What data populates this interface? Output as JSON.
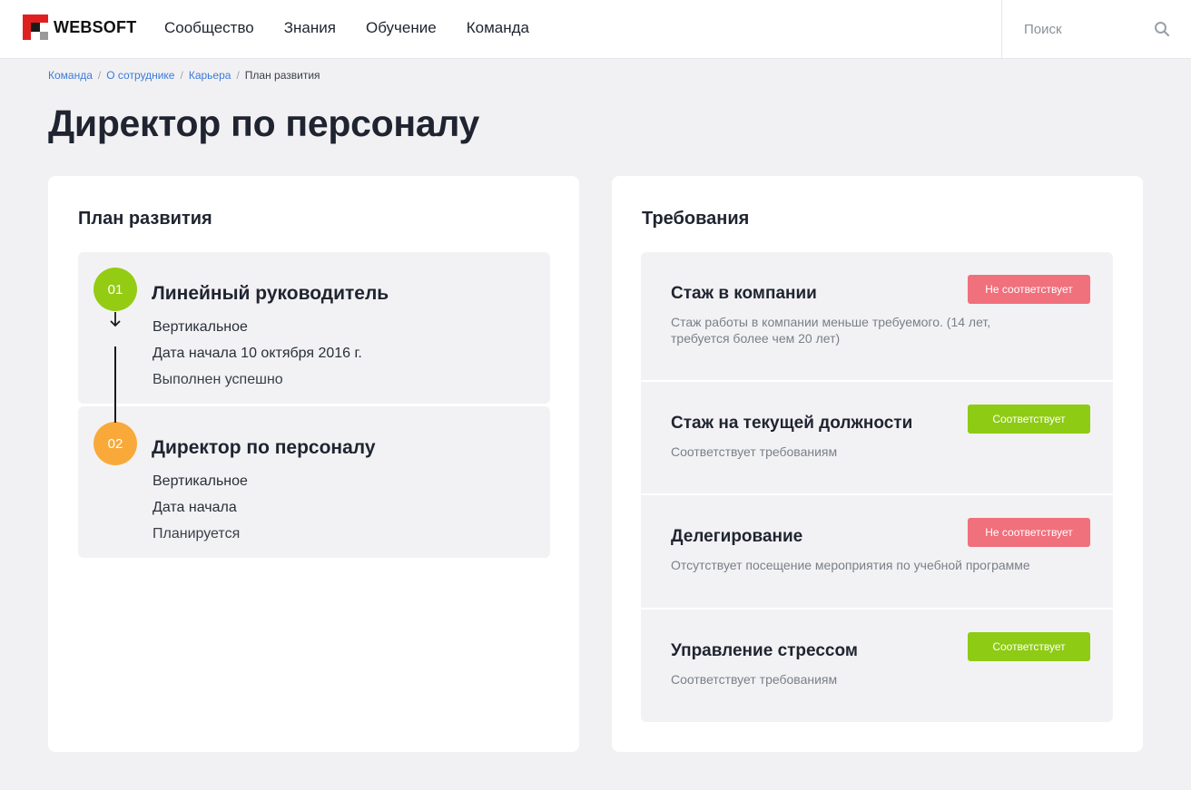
{
  "header": {
    "logo_text": "WEBSOFT",
    "nav": [
      "Сообщество",
      "Знания",
      "Обучение",
      "Команда"
    ],
    "search_placeholder": "Поиск"
  },
  "breadcrumb": {
    "links": [
      "Команда",
      "О сотруднике",
      "Карьера"
    ],
    "current": "План развития",
    "separator": "/"
  },
  "page_title": "Директор по персоналу",
  "plan": {
    "title": "План развития",
    "steps": [
      {
        "number": "01",
        "name": "Линейный руководитель",
        "direction": "Вертикальное",
        "start": "Дата начала 10 октября 2016 г.",
        "status": "Выполнен успешно",
        "color": "#94cc14"
      },
      {
        "number": "02",
        "name": "Директор по персоналу",
        "direction": "Вертикальное",
        "start": "Дата начала",
        "status": "Планируется",
        "color": "#f9a93a"
      }
    ]
  },
  "requirements": {
    "title": "Требования",
    "items": [
      {
        "name": "Стаж в компании",
        "description": "Стаж работы в компании меньше требуемого. (14 лет, требуется более чем 20 лет)",
        "status": "Не соответствует",
        "status_type": "bad"
      },
      {
        "name": "Стаж на текущей должности",
        "description": "Соответствует требованиям",
        "status": "Соответствует",
        "status_type": "good"
      },
      {
        "name": "Делегирование",
        "description": "Отсутствует посещение мероприятия по учебной программе",
        "status": "Не соответствует",
        "status_type": "bad"
      },
      {
        "name": "Управление стрессом",
        "description": "Соответствует требованиям",
        "status": "Соответствует",
        "status_type": "good"
      }
    ]
  },
  "colors": {
    "link": "#3d7ad8",
    "badge_bad": "#f0707c",
    "badge_good": "#8ecb14",
    "brand_red": "#e02020"
  }
}
